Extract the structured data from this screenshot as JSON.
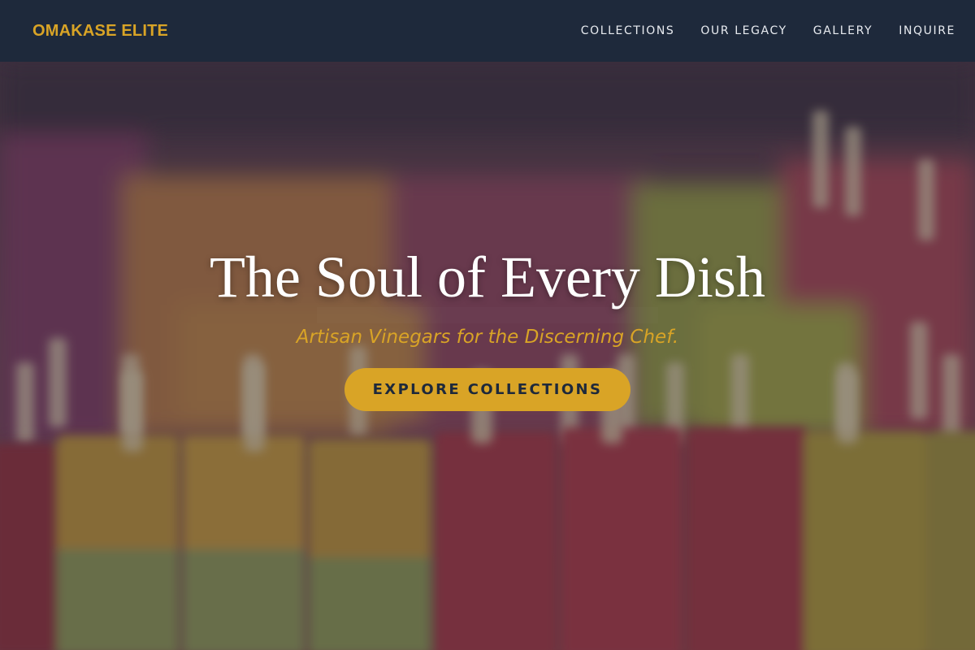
{
  "header": {
    "logo": "OMAKASE ELITE",
    "nav": [
      "COLLECTIONS",
      "OUR LEGACY",
      "GALLERY",
      "INQUIRE"
    ]
  },
  "hero": {
    "title": "The Soul of Every Dish",
    "subtitle": "Artisan Vinegars for the Discerning Chef.",
    "cta_label": "EXPLORE COLLECTIONS",
    "background_image": "blurred rows of colorful popsicles"
  },
  "colors": {
    "navbar": "#1e293b",
    "accent": "#d9a426",
    "nav_text": "#e8ebf0",
    "title": "#ffffff"
  }
}
